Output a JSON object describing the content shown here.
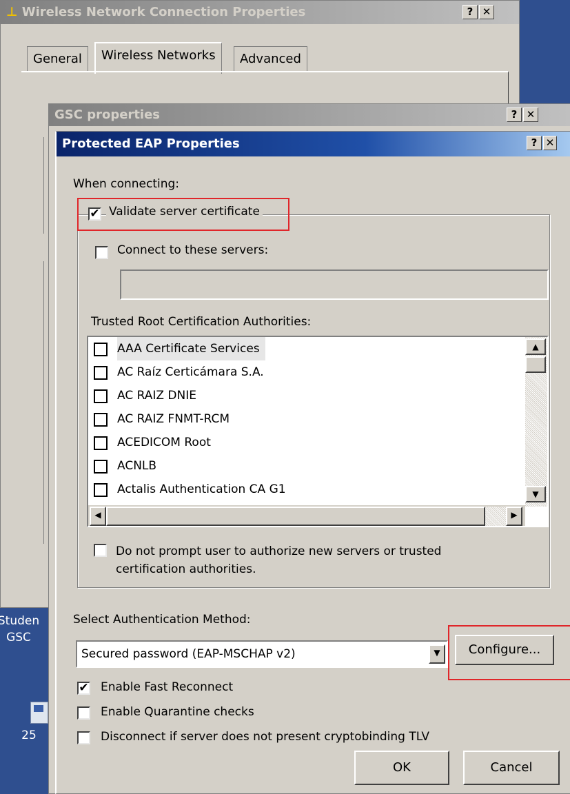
{
  "desktop": {
    "icon_label_1": "Studen",
    "icon_label_2": "GSC",
    "icon_label_3": "25"
  },
  "win1": {
    "title": "Wireless Network Connection Properties",
    "help": "?",
    "close": "✕",
    "tabs": [
      "General",
      "Wireless Networks",
      "Advanced"
    ]
  },
  "win2": {
    "title": "GSC properties",
    "help": "?",
    "close": "✕"
  },
  "peap": {
    "title": "Protected EAP Properties",
    "help": "?",
    "close": "✕",
    "when_connecting": "When connecting:",
    "validate_cert": {
      "label": "Validate server certificate",
      "checked": "✔"
    },
    "connect_servers": {
      "label": "Connect to these servers:",
      "value": ""
    },
    "trusted_label": "Trusted Root Certification Authorities:",
    "cas": [
      "AAA Certificate Services",
      "AC Raíz Certicámara S.A.",
      "AC RAIZ DNIE",
      "AC RAIZ FNMT-RCM",
      "ACEDICOM Root",
      "ACNLB",
      "Actalis Authentication CA G1"
    ],
    "no_prompt": "Do not prompt user to authorize new servers or trusted certification authorities.",
    "auth_method_label": "Select Authentication Method:",
    "auth_method_value": "Secured password (EAP-MSCHAP v2)",
    "configure": "Configure...",
    "fast_reconnect": {
      "label": "Enable Fast Reconnect",
      "checked": "✔"
    },
    "quarantine": "Enable Quarantine checks",
    "cryptobinding": "Disconnect if server does not present cryptobinding TLV",
    "ok": "OK",
    "cancel": "Cancel"
  },
  "scroll_glyphs": {
    "up": "▲",
    "down": "▼",
    "left": "◀",
    "right": "▶"
  }
}
